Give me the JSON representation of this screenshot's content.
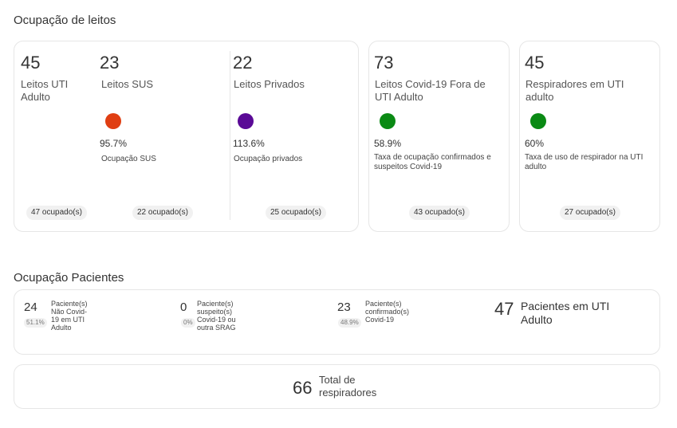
{
  "beds": {
    "title": "Ocupação de leitos",
    "uti": {
      "value": "45",
      "label": "Leitos UTI Adulto",
      "occupied": "47 ocupado(s)"
    },
    "sus": {
      "value": "23",
      "label": "Leitos SUS",
      "color": "#e03e12",
      "pct": "95.7%",
      "caption": "Ocupação SUS",
      "occupied": "22 ocupado(s)"
    },
    "private": {
      "value": "22",
      "label": "Leitos Privados",
      "color": "#5a0a96",
      "pct": "113.6%",
      "caption": "Ocupação privados",
      "occupied": "25 ocupado(s)"
    },
    "covid": {
      "value": "73",
      "label": "Leitos Covid-19 Fora de UTI Adulto",
      "color": "#0a8a14",
      "pct": "58.9%",
      "caption": "Taxa de ocupação confirmados e suspeitos Covid-19",
      "occupied": "43 ocupado(s)"
    },
    "resp": {
      "value": "45",
      "label": "Respiradores em UTI adulto",
      "color": "#0a8a14",
      "pct": "60%",
      "caption": "Taxa de uso de respirador na UTI adulto",
      "occupied": "27 ocupado(s)"
    }
  },
  "patients": {
    "title": "Ocupação Pacientes",
    "non_covid": {
      "value": "24",
      "pct": "51.1%",
      "label": "Paciente(s) Não Covid-19 em UTI Adulto"
    },
    "suspected": {
      "value": "0",
      "pct": "0%",
      "label": "Paciente(s) suspeito(s) Covid-19 ou outra SRAG"
    },
    "confirmed": {
      "value": "23",
      "pct": "48.9%",
      "label": "Paciente(s) confirmado(s) Covid-19"
    },
    "total": {
      "value": "47",
      "label": "Pacientes em UTI Adulto"
    }
  },
  "respirators": {
    "value": "66",
    "label": "Total de respiradores"
  }
}
